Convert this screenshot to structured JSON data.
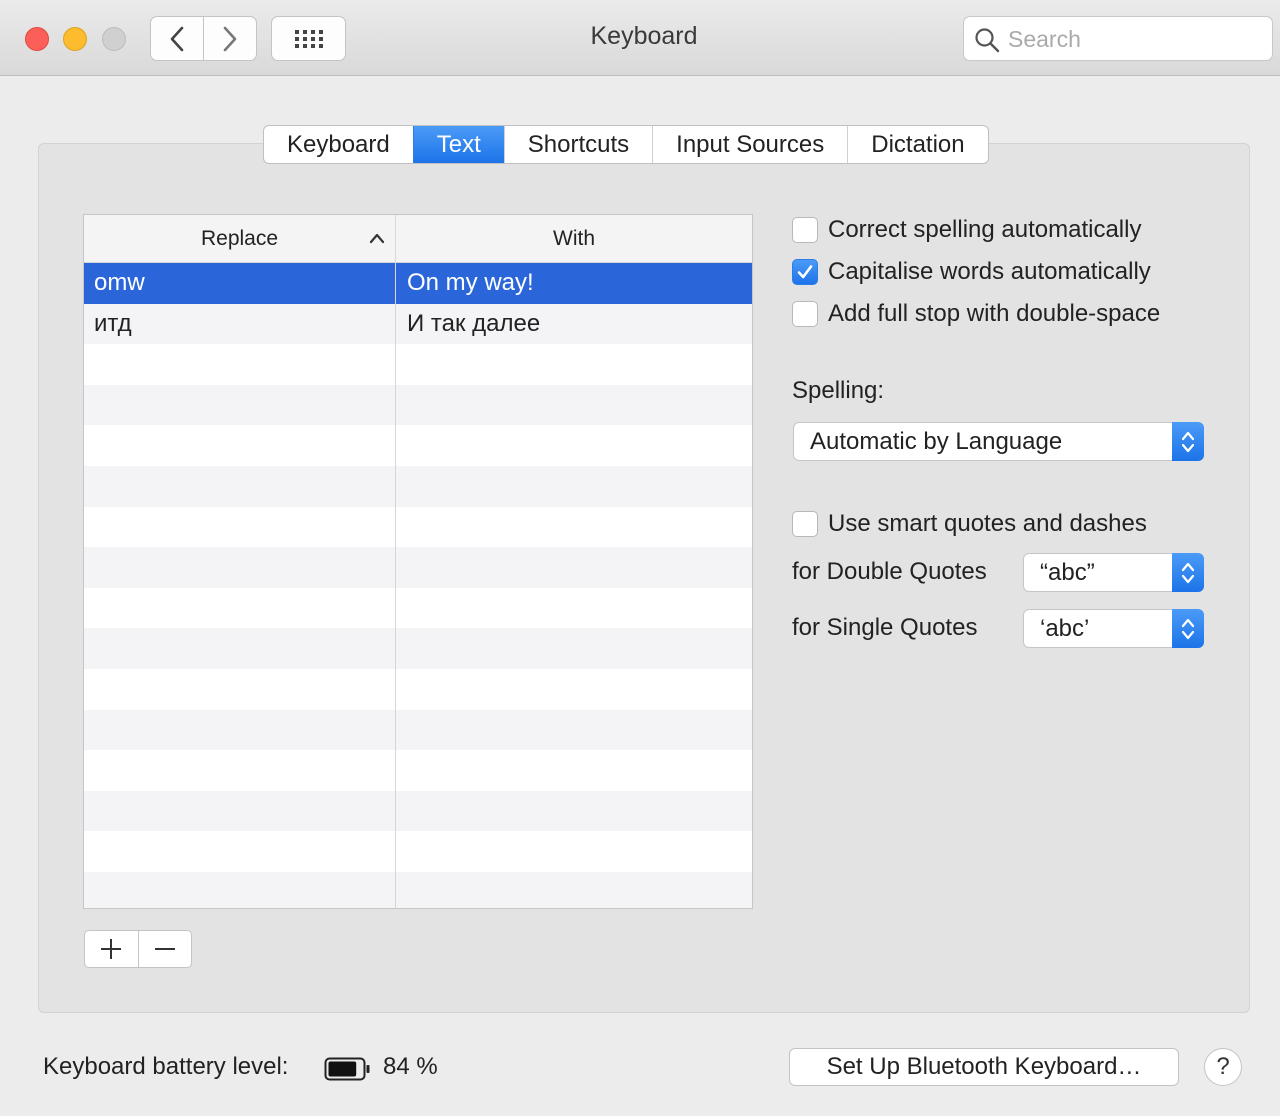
{
  "window": {
    "title": "Keyboard",
    "search_placeholder": "Search"
  },
  "tabs": [
    {
      "label": "Keyboard",
      "active": false
    },
    {
      "label": "Text",
      "active": true
    },
    {
      "label": "Shortcuts",
      "active": false
    },
    {
      "label": "Input Sources",
      "active": false
    },
    {
      "label": "Dictation",
      "active": false
    }
  ],
  "table": {
    "headers": {
      "replace": "Replace",
      "with": "With"
    },
    "rows": [
      {
        "replace": "omw",
        "with": "On my way!",
        "selected": true
      },
      {
        "replace": "итд",
        "with": "И так далее",
        "selected": false
      }
    ]
  },
  "options": {
    "correct_spelling": {
      "label": "Correct spelling automatically",
      "checked": false
    },
    "capitalise_words": {
      "label": "Capitalise words automatically",
      "checked": true
    },
    "full_stop": {
      "label": "Add full stop with double-space",
      "checked": false
    },
    "spelling_label": "Spelling:",
    "spelling_value": "Automatic by Language",
    "smart_quotes": {
      "label": "Use smart quotes and dashes",
      "checked": false
    },
    "double_quotes_label": "for Double Quotes",
    "double_quotes_value": "“abc”",
    "single_quotes_label": "for Single Quotes",
    "single_quotes_value": "‘abc’"
  },
  "footer": {
    "battery_label": "Keyboard battery level:",
    "battery_value": "84 %",
    "battery_level": 0.84,
    "bluetooth_button": "Set Up Bluetooth Keyboard…",
    "help_label": "?"
  },
  "colors": {
    "accent": "#1d73e8",
    "selection": "#2a66d9",
    "close": "#fc5f57",
    "minimize": "#fdbc2e",
    "zoom_disabled": "#d0d0d0"
  },
  "icons": [
    "close-icon",
    "minimize-icon",
    "zoom-icon",
    "back-icon",
    "forward-icon",
    "show-all-grid-icon",
    "search-icon",
    "sort-ascending-icon",
    "checkmark-icon",
    "popup-arrows-icon",
    "plus-icon",
    "minus-icon",
    "battery-icon"
  ]
}
